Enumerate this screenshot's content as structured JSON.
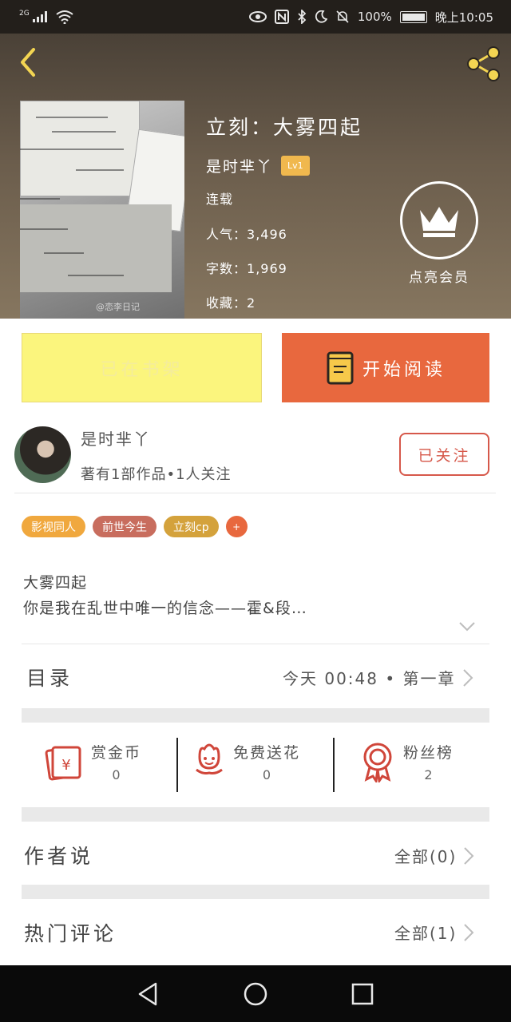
{
  "status_bar": {
    "network": "2G",
    "battery": "100%",
    "time": "晚上10:05"
  },
  "header": {
    "book_title": "立刻：大雾四起",
    "author_name": "是时芈丫",
    "level_badge": "Lv1",
    "status": "连载",
    "popularity_label": "人气：",
    "popularity_value": "3,496",
    "word_count_label": "字数：",
    "word_count_value": "1,969",
    "favorites_label": "收藏：",
    "favorites_value": "2",
    "vip_label": "点亮会员",
    "cover_watermark": "@恋李日记"
  },
  "actions": {
    "shelf_label": "已在书架",
    "read_label": "开始阅读"
  },
  "author": {
    "name": "是时芈丫",
    "stats": "著有1部作品•1人关注",
    "follow_label": "已关注"
  },
  "tags": [
    {
      "label": "影视同人",
      "color": "#f0a83e"
    },
    {
      "label": "前世今生",
      "color": "#c86d5e"
    },
    {
      "label": "立刻cp",
      "color": "#d4a23c"
    },
    {
      "label": "+",
      "color": "#e8683e"
    }
  ],
  "intro": {
    "line1": "大雾四起",
    "line2": "你是我在乱世中唯一的信念——霍&段…"
  },
  "catalog": {
    "title": "目录",
    "update_time": "今天 00:48 • 第一章"
  },
  "stats": [
    {
      "label": "赏金币",
      "value": "0",
      "icon": "red-envelope-icon"
    },
    {
      "label": "免费送花",
      "value": "0",
      "icon": "flower-icon"
    },
    {
      "label": "粉丝榜",
      "value": "2",
      "icon": "medal-icon"
    }
  ],
  "author_says": {
    "title": "作者说",
    "link": "全部(0)"
  },
  "hot_comments": {
    "title": "热门评论",
    "link": "全部(1)"
  },
  "colors": {
    "accent": "#e8683e",
    "shelf_button": "#fbf57d",
    "follow": "#d6584a",
    "icon_red": "#d0463a",
    "lv_badge": "#f0b84e",
    "back_arrow": "#f3d552"
  }
}
